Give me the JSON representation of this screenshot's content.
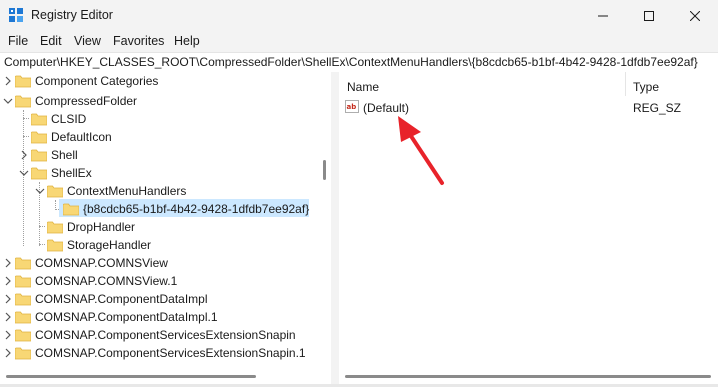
{
  "window": {
    "title": "Registry Editor",
    "controls": {
      "minimize": "minimize",
      "maximize": "maximize",
      "close": "close"
    }
  },
  "menu": [
    "File",
    "Edit",
    "View",
    "Favorites",
    "Help"
  ],
  "address": "Computer\\HKEY_CLASSES_ROOT\\CompressedFolder\\ShellEx\\ContextMenuHandlers\\{b8cdcb65-b1bf-4b42-9428-1dfdb7ee92af}",
  "tree": {
    "items": [
      {
        "label": "Component Categories",
        "expanded": false
      },
      {
        "label": "CompressedFolder",
        "expanded": true
      },
      {
        "label": "CLSID",
        "expanded": false
      },
      {
        "label": "DefaultIcon",
        "expanded": false
      },
      {
        "label": "Shell",
        "expanded": false
      },
      {
        "label": "ShellEx",
        "expanded": true
      },
      {
        "label": "ContextMenuHandlers",
        "expanded": true
      },
      {
        "label": "{b8cdcb65-b1bf-4b42-9428-1dfdb7ee92af}",
        "selected": true
      },
      {
        "label": "DropHandler",
        "expanded": false
      },
      {
        "label": "StorageHandler",
        "expanded": false
      },
      {
        "label": "COMSNAP.COMNSView",
        "expanded": false
      },
      {
        "label": "COMSNAP.COMNSView.1",
        "expanded": false
      },
      {
        "label": "COMSNAP.ComponentDataImpl",
        "expanded": false
      },
      {
        "label": "COMSNAP.ComponentDataImpl.1",
        "expanded": false
      },
      {
        "label": "COMSNAP.ComponentServicesExtensionSnapin",
        "expanded": false
      },
      {
        "label": "COMSNAP.ComponentServicesExtensionSnapin.1",
        "expanded": false
      }
    ]
  },
  "list": {
    "columns": [
      "Name",
      "Type"
    ],
    "rows": [
      {
        "name": "(Default)",
        "type": "REG_SZ"
      }
    ]
  },
  "colors": {
    "selection": "#cce8ff",
    "folder": "#f8d775",
    "folder_dark": "#e0b340",
    "arrow": "#e8232a"
  }
}
